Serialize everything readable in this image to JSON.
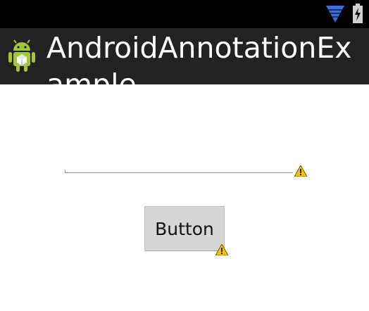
{
  "status_bar": {
    "icons": [
      "wifi-icon",
      "battery-charging-icon"
    ],
    "background": "#000000"
  },
  "action_bar": {
    "title": "AndroidAnnotationExample",
    "icon": "android-robot-icon",
    "background": "#222222"
  },
  "main": {
    "text_field": {
      "value": "",
      "warning_icon": "warning-icon"
    },
    "button": {
      "label": "Button",
      "warning_icon": "warning-icon"
    }
  },
  "colors": {
    "android_green": "#a4c639",
    "wifi_blue": "#3a6fd6",
    "warning_yellow": "#f2c31b"
  }
}
